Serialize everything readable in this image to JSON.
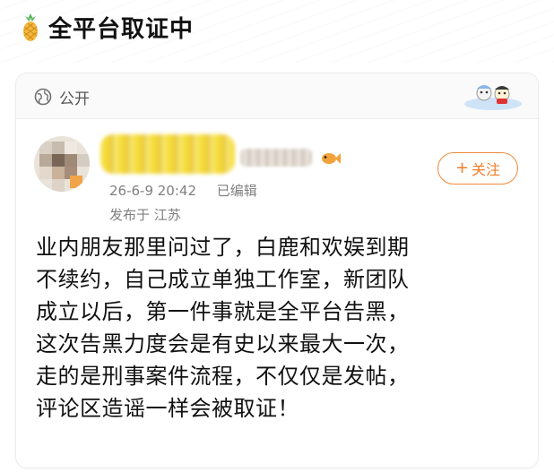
{
  "header": {
    "title": "全平台取证中",
    "icon": "pineapple-icon"
  },
  "visibility": {
    "label": "公开",
    "icon": "globe-icon"
  },
  "post": {
    "date": "26-6-9 20:42",
    "edited": "已编辑",
    "location": "发布于 江苏",
    "follow_label": "关注",
    "follow_icon": "plus-icon",
    "body": "业内朋友那里问过了，白鹿和欢娱到期\n不续约，自己成立单独工作室，新团队\n成立以后，第一件事就是全平台告黑，\n这次告黑力度会是有史以来最大一次，\n走的是刑事案件流程，不仅仅是发帖，\n评论区造谣一样会被取证！"
  },
  "colors": {
    "accent": "#f07d2a",
    "meta_text": "#808080"
  }
}
